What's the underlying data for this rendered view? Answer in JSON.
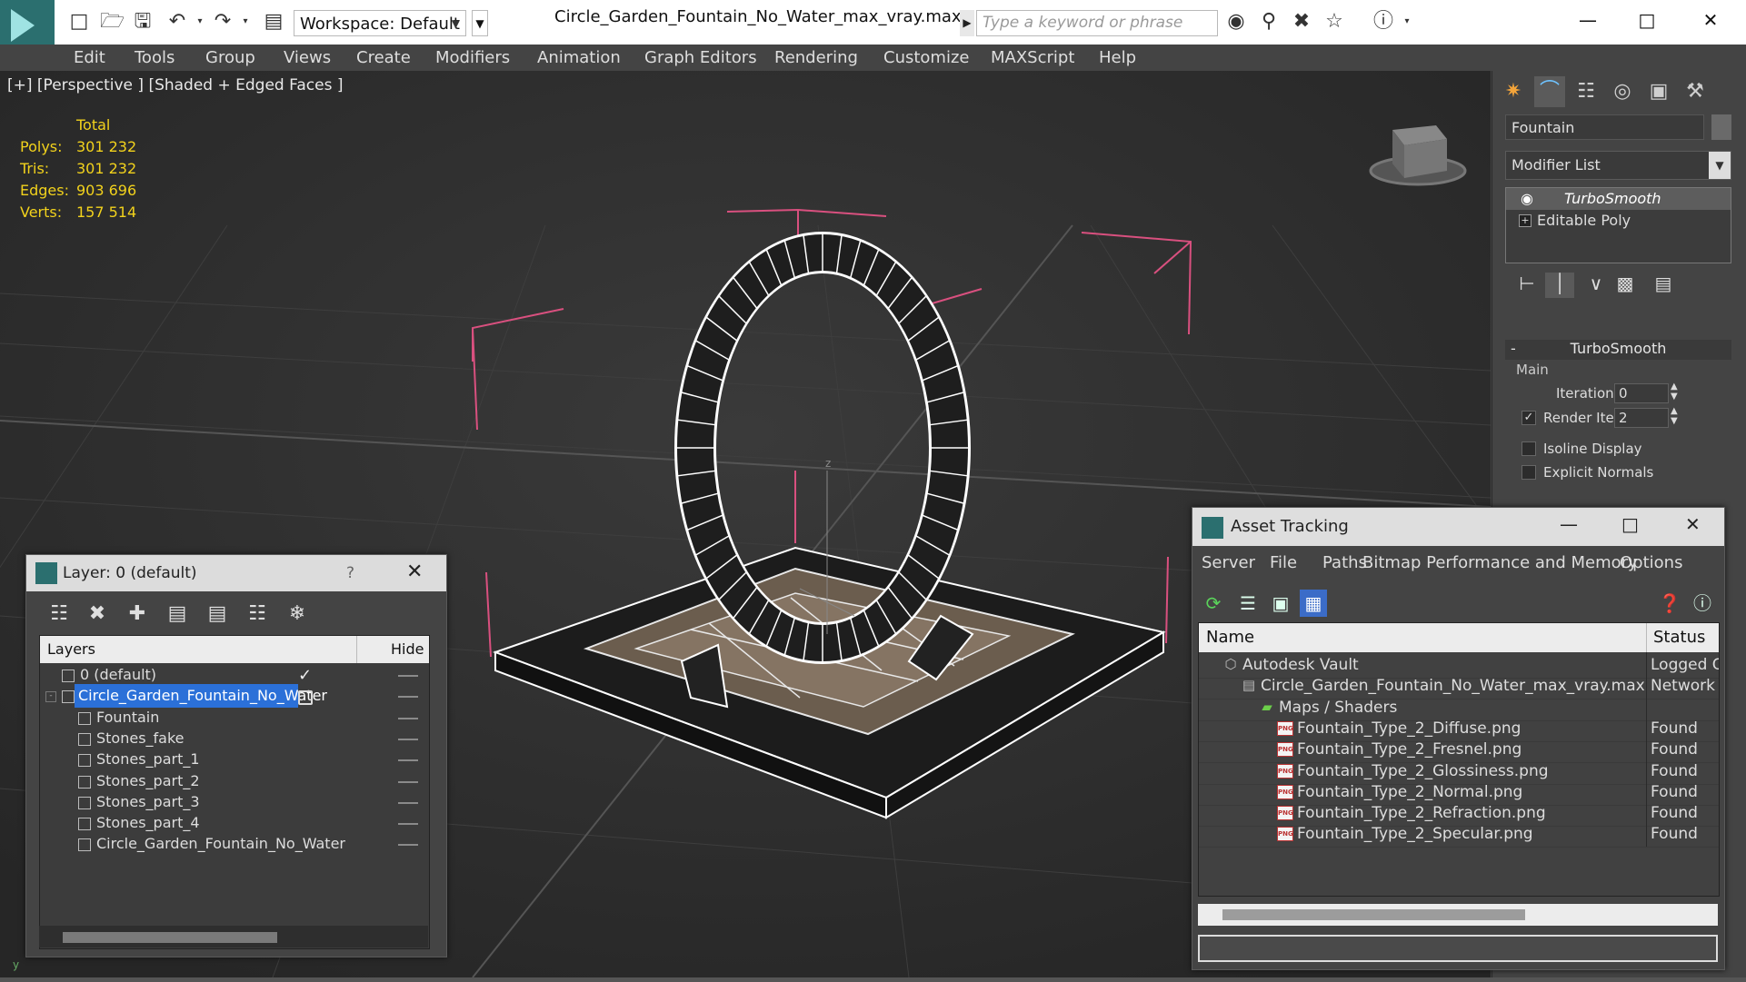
{
  "window": {
    "title": "Circle_Garden_Fountain_No_Water_max_vray.max",
    "workspace_label": "Workspace: Default",
    "search_placeholder": "Type a keyword or phrase"
  },
  "menu": [
    "Edit",
    "Tools",
    "Group",
    "Views",
    "Create",
    "Modifiers",
    "Animation",
    "Graph Editors",
    "Rendering",
    "Customize",
    "MAXScript",
    "Help"
  ],
  "viewport": {
    "label": "[+] [Perspective ] [Shaded + Edged Faces ]",
    "stats_header": "Total",
    "stats": [
      {
        "label": "Polys:",
        "value": "301 232"
      },
      {
        "label": "Tris:",
        "value": "301 232"
      },
      {
        "label": "Edges:",
        "value": "903 696"
      },
      {
        "label": "Verts:",
        "value": "157 514"
      }
    ],
    "axis_label": "z"
  },
  "command_panel": {
    "object_name": "Fountain",
    "modifier_list": "Modifier List",
    "stack": [
      {
        "label": "TurboSmooth"
      },
      {
        "label": "Editable Poly"
      }
    ],
    "rollout_title": "TurboSmooth",
    "main_label": "Main",
    "iterations_label": "Iterations:",
    "iterations_value": "0",
    "render_iters_label": "Render Iters:",
    "render_iters_value": "2",
    "render_iters_checked": true,
    "isoline_label": "Isoline Display",
    "explicit_normals_label": "Explicit Normals"
  },
  "layer_dialog": {
    "title": "Layer: 0 (default)",
    "help": "?",
    "col_layers": "Layers",
    "col_hide": "Hide",
    "rows": [
      {
        "name": "0 (default)",
        "level": 0,
        "selected": false,
        "current": true
      },
      {
        "name": "Circle_Garden_Fountain_No_Water",
        "level": 0,
        "selected": true,
        "current": false
      },
      {
        "name": "Fountain",
        "level": 1,
        "selected": false,
        "current": false
      },
      {
        "name": "Stones_fake",
        "level": 1,
        "selected": false,
        "current": false
      },
      {
        "name": "Stones_part_1",
        "level": 1,
        "selected": false,
        "current": false
      },
      {
        "name": "Stones_part_2",
        "level": 1,
        "selected": false,
        "current": false
      },
      {
        "name": "Stones_part_3",
        "level": 1,
        "selected": false,
        "current": false
      },
      {
        "name": "Stones_part_4",
        "level": 1,
        "selected": false,
        "current": false
      },
      {
        "name": "Circle_Garden_Fountain_No_Water",
        "level": 1,
        "selected": false,
        "current": false
      }
    ]
  },
  "asset_dialog": {
    "title": "Asset Tracking",
    "menus": [
      "Server",
      "File",
      "Paths",
      "Bitmap Performance and Memory",
      "Options"
    ],
    "col_name": "Name",
    "col_status": "Status",
    "rows": [
      {
        "name": "Autodesk Vault",
        "status": "Logged O",
        "level": 0,
        "icon": "vault-icon"
      },
      {
        "name": "Circle_Garden_Fountain_No_Water_max_vray.max",
        "status": "Network",
        "level": 1,
        "icon": "max-file-icon"
      },
      {
        "name": "Maps / Shaders",
        "status": "",
        "level": 2,
        "icon": "maps-folder-icon"
      },
      {
        "name": "Fountain_Type_2_Diffuse.png",
        "status": "Found",
        "level": 3,
        "icon": "png-icon"
      },
      {
        "name": "Fountain_Type_2_Fresnel.png",
        "status": "Found",
        "level": 3,
        "icon": "png-icon"
      },
      {
        "name": "Fountain_Type_2_Glossiness.png",
        "status": "Found",
        "level": 3,
        "icon": "png-icon"
      },
      {
        "name": "Fountain_Type_2_Normal.png",
        "status": "Found",
        "level": 3,
        "icon": "png-icon"
      },
      {
        "name": "Fountain_Type_2_Refraction.png",
        "status": "Found",
        "level": 3,
        "icon": "png-icon"
      },
      {
        "name": "Fountain_Type_2_Specular.png",
        "status": "Found",
        "level": 3,
        "icon": "png-icon"
      }
    ]
  },
  "colors": {
    "stats_text": "#f2d21c",
    "selection_blue": "#2b70d8",
    "viewport_bg": "#2f2f2f",
    "bounding_box": "#d9507f"
  }
}
